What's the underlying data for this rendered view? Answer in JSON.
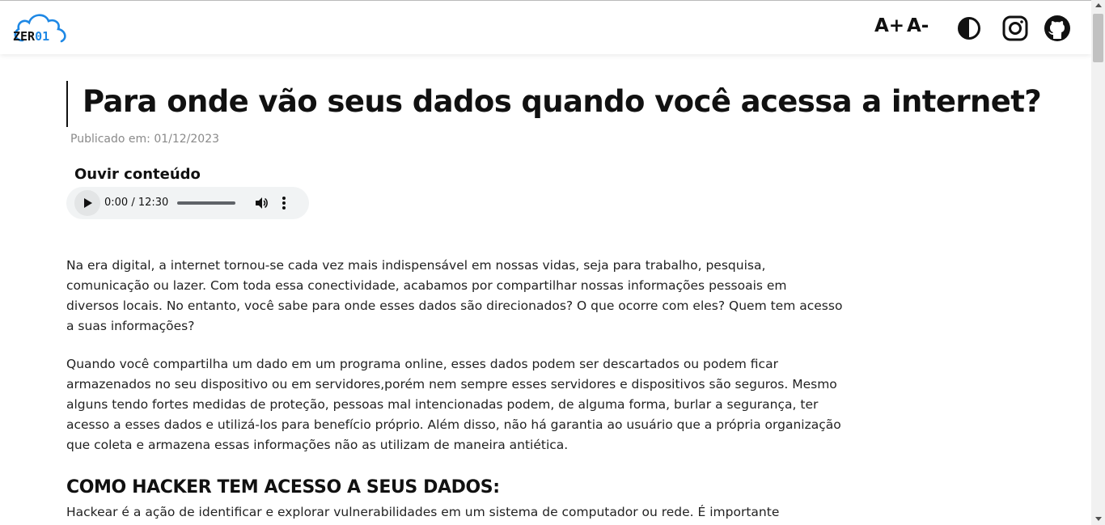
{
  "header": {
    "logo_text": "ZER",
    "logo_text_accent": "01",
    "font_increase_label": "A+",
    "font_decrease_label": "A-",
    "icons": [
      "contrast-icon",
      "instagram-icon",
      "github-icon"
    ]
  },
  "article": {
    "title": "Para onde vão seus dados quando você acessa a internet?",
    "published": "Publicado em: 01/12/2023",
    "listen_label": "Ouvir conteúdo",
    "audio": {
      "time": "0:00 / 12:30"
    },
    "paragraphs": [
      "Na era digital, a internet tornou-se cada vez mais indispensável em nossas vidas, seja para trabalho, pesquisa, comunicação ou lazer. Com toda essa conectividade, acabamos por compartilhar nossas informações pessoais em diversos locais. No entanto, você sabe para onde esses dados são direcionados? O que ocorre com eles? Quem tem acesso a suas informações?",
      "Quando você compartilha um dado em um programa online, esses dados podem ser descartados ou podem ficar armazenados no seu dispositivo ou em servidores,porém nem sempre esses servidores e dispositivos são seguros. Mesmo alguns tendo fortes medidas de proteção, pessoas mal intencionadas podem, de alguma forma, burlar a segurança, ter acesso a esses dados e utilizá-los para benefício próprio. Além disso, não há garantia ao usuário que a própria organização que coleta e armazena essas informações não as utilizam de maneira antiética."
    ],
    "section_heading": "COMO HACKER TEM ACESSO A SEUS DADOS:",
    "section_paragraph": "Hackear é a ação de identificar e explorar vulnerabilidades em um sistema de computador ou rede. É importante"
  },
  "colors": {
    "accent": "#1e88e5",
    "text": "#111111",
    "muted": "#8a8a8a"
  }
}
